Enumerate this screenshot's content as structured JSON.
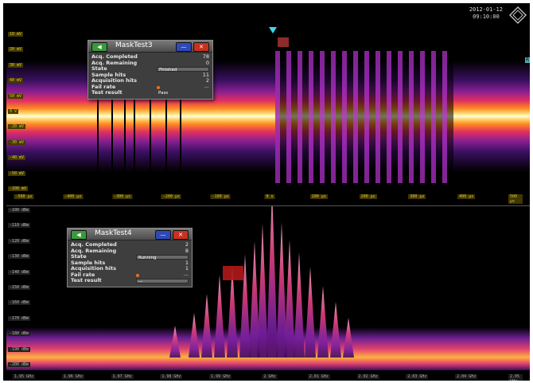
{
  "scope": {
    "date": "2012-01-12",
    "time": "09:10:00"
  },
  "time_panel": {
    "y_labels": [
      "10 mV",
      "20 mV",
      "30 mV",
      "40 mV",
      "50 mV",
      "0 V",
      "-20 mV",
      "-30 mV",
      "-40 mV",
      "-50 mV",
      "-100 mV"
    ],
    "x_labels": [
      "-500 µs",
      "-400 µs",
      "-300 µs",
      "-200 µs",
      "-100 µs",
      "0 s",
      "100 µs",
      "200 µs",
      "300 µs",
      "400 µs",
      "500 µs"
    ],
    "right_marker": "R1"
  },
  "spectrum_panel": {
    "y_labels": [
      "-100 dBm",
      "-110 dBm",
      "-120 dBm",
      "-130 dBm",
      "-140 dBm",
      "-150 dBm",
      "-160 dBm",
      "-170 dBm",
      "-180 dBm",
      "-190 dBm",
      "-200 dBm"
    ],
    "x_labels": [
      "1.95 GHz",
      "1.96 GHz",
      "1.97 GHz",
      "1.98 GHz",
      "1.99 GHz",
      "2 GHz",
      "2.01 GHz",
      "2.02 GHz",
      "2.03 GHz",
      "2.04 GHz",
      "2.05 GHz"
    ]
  },
  "dialog_time": {
    "title": "MaskTest3",
    "rows": [
      {
        "label": "Acq. Completed",
        "value": "78"
      },
      {
        "label": "Acq. Remaining",
        "value": "0"
      },
      {
        "label": "State",
        "value": "Finished"
      },
      {
        "label": "Sample hits",
        "value": "11"
      },
      {
        "label": "Acquisition hits",
        "value": "2"
      },
      {
        "label": "Fail rate",
        "value": "—"
      },
      {
        "label": "Test result",
        "value": "Pass"
      }
    ]
  },
  "dialog_spec": {
    "title": "MaskTest4",
    "rows": [
      {
        "label": "Acq. Completed",
        "value": "2"
      },
      {
        "label": "Acq. Remaining",
        "value": "8"
      },
      {
        "label": "State",
        "value": "Running"
      },
      {
        "label": "Sample hits",
        "value": "1"
      },
      {
        "label": "Acquisition hits",
        "value": "1"
      },
      {
        "label": "Fail rate",
        "value": "—"
      },
      {
        "label": "Test result",
        "value": "—"
      }
    ]
  },
  "colors": {
    "persistence_hot": "#ffffc0",
    "persistence_warm": "#ff9020",
    "persistence_mid": "#e03070",
    "persistence_cool": "#7a20a0",
    "axis_label": "#d8c840"
  },
  "icons": {
    "nav": "arrow-left-icon",
    "minimize": "minimize-icon",
    "close": "close-icon",
    "logo": "rohde-schwarz-logo"
  }
}
